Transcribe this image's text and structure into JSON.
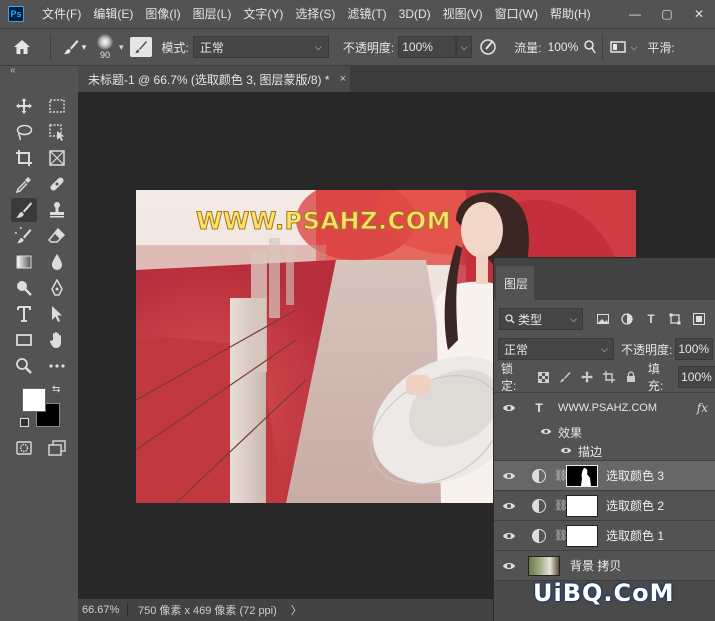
{
  "app": {
    "logo": "Ps"
  },
  "menu": [
    "文件(F)",
    "编辑(E)",
    "图像(I)",
    "图层(L)",
    "文字(Y)",
    "选择(S)",
    "滤镜(T)",
    "3D(D)",
    "视图(V)",
    "窗口(W)",
    "帮助(H)"
  ],
  "window_controls": {
    "minimize": "—",
    "maximize": "▢",
    "close": "✕"
  },
  "options": {
    "brush_size": "90",
    "mode_label": "模式:",
    "mode_value": "正常",
    "opacity_label": "不透明度:",
    "opacity_value": "100%",
    "flow_label": "流量:",
    "flow_value": "100%",
    "smoothing_label": "平滑:"
  },
  "toolbar": {
    "collapse": "«"
  },
  "document": {
    "tab_title": "未标题-1 @ 66.7% (选取颜色 3, 图层蒙版/8) *",
    "tab_close": "×",
    "watermark": "WWW.PSAHZ.COM"
  },
  "statusbar": {
    "zoom": "66.67%",
    "info": "750 像素 x 469 像素 (72 ppi)",
    "arrow": "〉"
  },
  "layers_panel": {
    "tab": "图层",
    "filter_kind": "类型",
    "blend_mode": "正常",
    "opacity_label": "不透明度:",
    "opacity_value": "100%",
    "lock_label": "锁定:",
    "fill_label": "填充:",
    "fill_value": "100%",
    "text_layer": {
      "name": "WWW.PSAHZ.COM",
      "fx": "fx",
      "effects_label": "效果",
      "stroke_label": "描边"
    },
    "layers": [
      {
        "name": "选取颜色 3",
        "selected": true
      },
      {
        "name": "选取颜色 2",
        "selected": false
      },
      {
        "name": "选取颜色 1",
        "selected": false
      }
    ],
    "background_layer": {
      "name": "背景 拷贝"
    }
  },
  "site_watermark": "UiBQ.CoM",
  "colors": {
    "accent": "#31a8ff",
    "panel": "#535353",
    "canvas_bg": "#282828",
    "watermark_text": "#fde06a"
  }
}
